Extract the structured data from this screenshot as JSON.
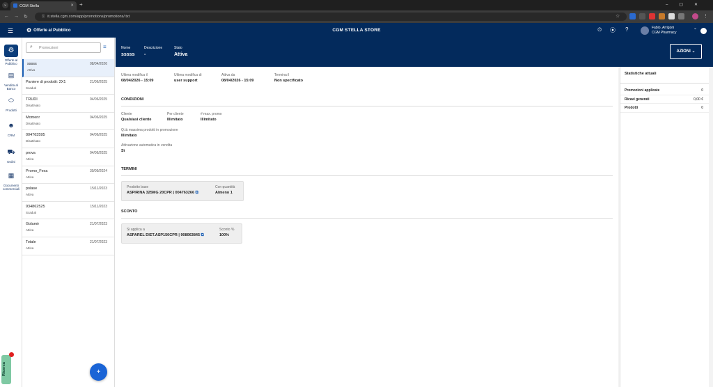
{
  "browser": {
    "tab_title": "CGM Stella",
    "url": "it.stella.cgm.com/app/promotions/promotions/.txt"
  },
  "header": {
    "section": "Offerte al Pubblico",
    "brand": "CGM STELLA STORE",
    "user_name": "Fabio, Arrigoni",
    "user_org": "CGM Pharmacy"
  },
  "rail": [
    {
      "label": "Offerte al Pubblico",
      "icon": "gear-icon"
    },
    {
      "label": "Vendita al Banco",
      "icon": "register-icon"
    },
    {
      "label": "Prodotti",
      "icon": "pill-icon"
    },
    {
      "label": "CRM",
      "icon": "people-icon"
    },
    {
      "label": "Ordini",
      "icon": "cart-icon"
    },
    {
      "label": "Documenti commerciali",
      "icon": "document-icon"
    }
  ],
  "ricerca": "Ricerca",
  "list": {
    "search_placeholder": "Promozioni",
    "items": [
      {
        "name": "sssss",
        "status": "Attiva",
        "date": "08/04/2026"
      },
      {
        "name": "Paniere di prodotti: 2X1",
        "status": "Scaduti",
        "date": "21/06/2025"
      },
      {
        "name": "TRUDI",
        "status": "Disattivato",
        "date": "04/06/2025"
      },
      {
        "name": "Momenr",
        "status": "Disattivato",
        "date": "04/06/2025"
      },
      {
        "name": "004763595",
        "status": "Disattivato",
        "date": "04/06/2025"
      },
      {
        "name": "prova",
        "status": "Attiva",
        "date": "04/06/2025"
      },
      {
        "name": "Promo_Fexa",
        "status": "Attiva",
        "date": "30/09/2024"
      },
      {
        "name": "polase",
        "status": "Attiva",
        "date": "15/11/2023"
      },
      {
        "name": "934862525",
        "status": "Scaduti",
        "date": "15/11/2023"
      },
      {
        "name": "Golamir",
        "status": "Attiva",
        "date": "21/07/2023"
      },
      {
        "name": "Totale",
        "status": "Attiva",
        "date": "21/07/2023"
      }
    ]
  },
  "detail": {
    "nome_label": "Nome",
    "nome": "sssss",
    "descrizione_label": "Descrizione",
    "descrizione": "-",
    "stato_label": "Stato",
    "stato": "Attiva",
    "azioni": "AZIONI",
    "meta": [
      {
        "label": "Ultima modifica il",
        "value": "08/04/2026 - 15:09"
      },
      {
        "label": "Ultima modifica di",
        "value": "user support"
      },
      {
        "label": "Attiva da",
        "value": "08/04/2026 - 15:09"
      },
      {
        "label": "Termina il",
        "value": "Non specificato"
      }
    ],
    "condizioni_title": "CONDIZIONI",
    "condizioni": [
      {
        "label": "Cliente",
        "value": "Qualsiasi cliente"
      },
      {
        "label": "Per cliente",
        "value": "Illimitato"
      },
      {
        "label": "# max. promo",
        "value": "Illimitato"
      }
    ],
    "qta_label": "Q.tà massima prodotti in promozione",
    "qta_value": "Illimitato",
    "auto_label": "Attivazione automatica in vendita",
    "auto_value": "Sì",
    "termini_title": "TERMINI",
    "termini": {
      "prodotto_label": "Prodotto base",
      "prodotto_value": "ASPIRINA 325MG 20CPR",
      "prodotto_code": "004763266",
      "qta_label": "Con quantità",
      "qta_value": "Almeno 1"
    },
    "sconto_title": "SCONTO",
    "sconto": {
      "applica_label": "Si applica a",
      "applica_value": "ASPAREL DIET.ASP150CPR",
      "applica_code": "908063845",
      "sconto_label": "Sconto %",
      "sconto_value": "100%"
    }
  },
  "stats": {
    "title": "Statistiche attuali",
    "rows": [
      {
        "label": "Promozioni applicate",
        "value": "0"
      },
      {
        "label": "Ricavi generati",
        "value": "0,00 €"
      },
      {
        "label": "Prodotti",
        "value": "0"
      }
    ]
  }
}
